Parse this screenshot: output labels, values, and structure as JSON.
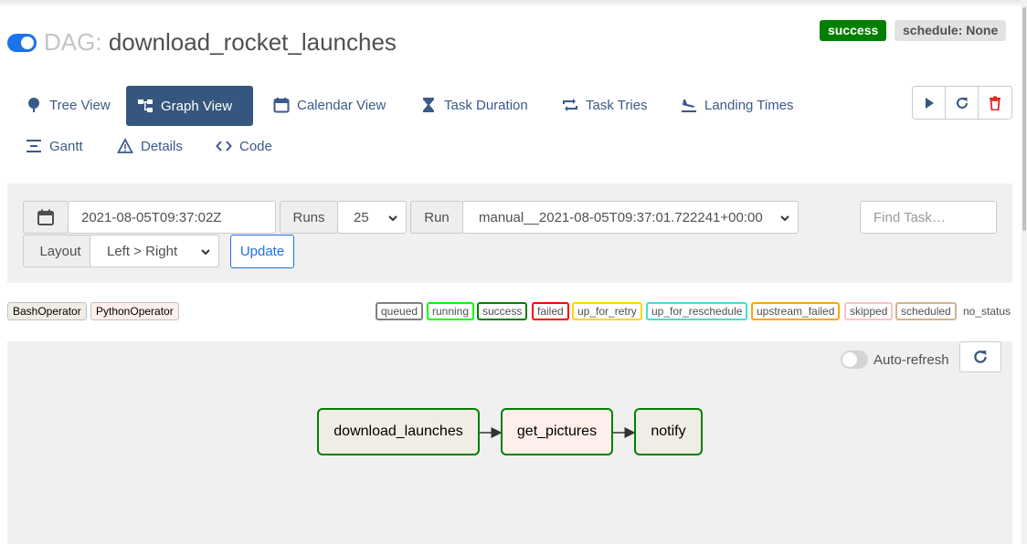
{
  "dag": {
    "prefix": "DAG:",
    "name": "download_rocket_launches"
  },
  "badges": {
    "status": "success",
    "schedule": "schedule: None"
  },
  "nav": {
    "tree": "Tree View",
    "graph": "Graph View",
    "calendar": "Calendar View",
    "duration": "Task Duration",
    "tries": "Task Tries",
    "landing": "Landing Times",
    "gantt": "Gantt",
    "details": "Details",
    "code": "Code"
  },
  "filters": {
    "base_date": "2021-08-05T09:37:02Z",
    "runs_label": "Runs",
    "runs_value": "25",
    "run_label": "Run",
    "run_value": "manual__2021-08-05T09:37:01.722241+00:00",
    "find_placeholder": "Find Task…",
    "layout_label": "Layout",
    "layout_value": "Left > Right",
    "update": "Update"
  },
  "operators": [
    "BashOperator",
    "PythonOperator"
  ],
  "operator_colors": [
    "#f0ede4",
    "#ffefeb"
  ],
  "states": [
    {
      "label": "queued",
      "color": "#808080"
    },
    {
      "label": "running",
      "color": "#00ff00"
    },
    {
      "label": "success",
      "color": "#008000"
    },
    {
      "label": "failed",
      "color": "#ff0000"
    },
    {
      "label": "up_for_retry",
      "color": "#ffd700"
    },
    {
      "label": "up_for_reschedule",
      "color": "#40e0d0"
    },
    {
      "label": "upstream_failed",
      "color": "#ffa500"
    },
    {
      "label": "skipped",
      "color": "#ffc0cb"
    },
    {
      "label": "scheduled",
      "color": "#d2b48c"
    },
    {
      "label": "no_status",
      "color": ""
    }
  ],
  "graph": {
    "autorefresh": "Auto-refresh",
    "tasks": [
      {
        "id": "download_launches",
        "operator": "BashOperator",
        "state": "success"
      },
      {
        "id": "get_pictures",
        "operator": "PythonOperator",
        "state": "success"
      },
      {
        "id": "notify",
        "operator": "BashOperator",
        "state": "success"
      }
    ]
  },
  "colors": {
    "accent": "#1a73e8",
    "nav_active": "#35577d",
    "success": "#008000"
  }
}
